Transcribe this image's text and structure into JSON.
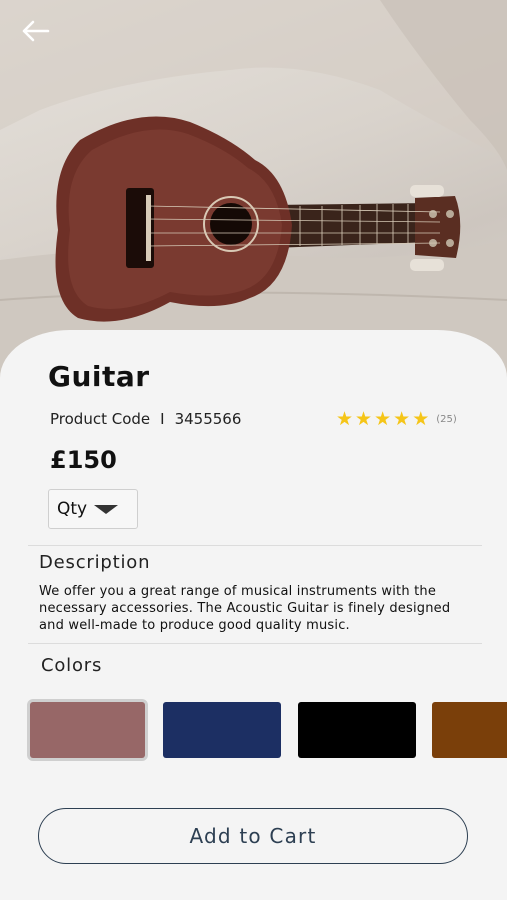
{
  "product": {
    "title": "Guitar",
    "code_label": "Product Code",
    "code_separator": "I",
    "code_value": "3455566",
    "rating_value": 5,
    "rating_count": "(25)",
    "price": "£150",
    "qty_label": "Qty"
  },
  "description": {
    "heading": "Description",
    "text": "We offer you a great range of musical instruments with the necessary accessories. The Acoustic Guitar is finely designed and well-made to produce good quality music."
  },
  "colors": {
    "heading": "Colors",
    "options": [
      {
        "name": "dusty-rose",
        "hex": "#976767",
        "selected": true
      },
      {
        "name": "navy",
        "hex": "#1c2f63",
        "selected": false
      },
      {
        "name": "black",
        "hex": "#000000",
        "selected": false
      },
      {
        "name": "brown",
        "hex": "#7a3f0a",
        "selected": false
      }
    ]
  },
  "actions": {
    "add_to_cart": "Add to Cart"
  },
  "icons": {
    "back": "arrow-left-icon",
    "qty_dropdown": "caret-down-icon",
    "star": "star-icon"
  }
}
